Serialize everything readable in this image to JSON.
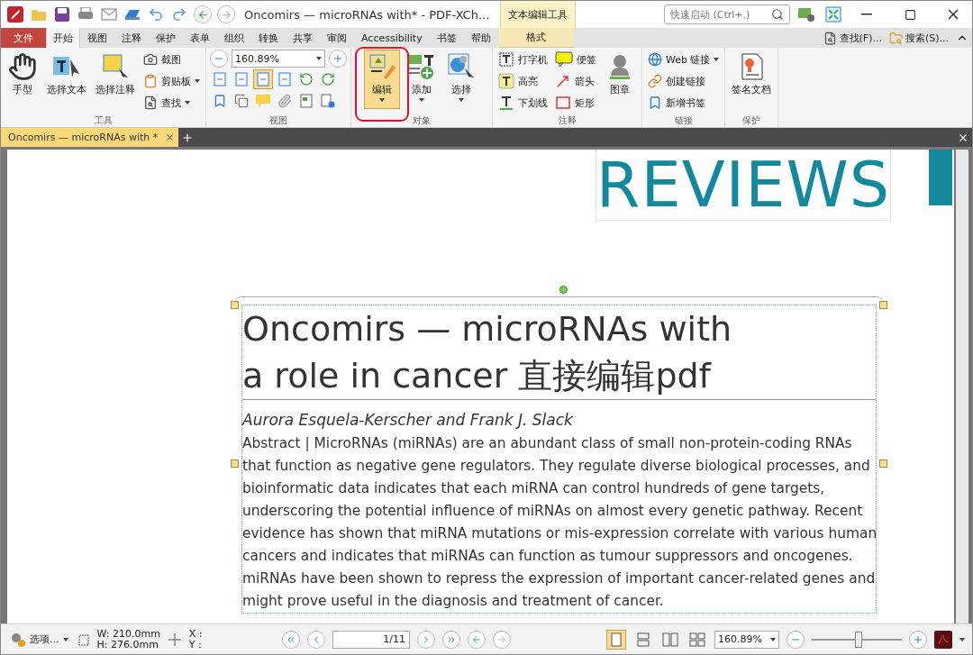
{
  "title_bar": {
    "title": "Oncomirs — microRNAs with* - PDF-XCh...",
    "context_header": "文本编辑工具",
    "quick_launch": {
      "placeholder": "快速启动 (Ctrl+.)"
    }
  },
  "menu_tabs": [
    {
      "label": "文件",
      "kind": "file",
      "selected": false
    },
    {
      "label": "开始",
      "kind": "tab",
      "selected": true
    },
    {
      "label": "视图",
      "kind": "tab",
      "selected": false
    },
    {
      "label": "注释",
      "kind": "tab",
      "selected": false
    },
    {
      "label": "保护",
      "kind": "tab",
      "selected": false
    },
    {
      "label": "表单",
      "kind": "tab",
      "selected": false
    },
    {
      "label": "组织",
      "kind": "tab",
      "selected": false
    },
    {
      "label": "转换",
      "kind": "tab",
      "selected": false
    },
    {
      "label": "共享",
      "kind": "tab",
      "selected": false
    },
    {
      "label": "审阅",
      "kind": "tab",
      "selected": false
    },
    {
      "label": "Accessibility",
      "kind": "tab",
      "selected": false
    },
    {
      "label": "书签",
      "kind": "tab",
      "selected": false
    },
    {
      "label": "帮助",
      "kind": "tab",
      "selected": false
    },
    {
      "label": "格式",
      "kind": "context",
      "selected": false
    }
  ],
  "menu_right": [
    {
      "label": "查找(F)..."
    },
    {
      "label": "搜索(S)..."
    }
  ],
  "ribbon": {
    "tools": {
      "label": "工具",
      "large": [
        {
          "label": "手型"
        },
        {
          "label": "选择文本"
        },
        {
          "label": "选择注释"
        }
      ],
      "small": [
        {
          "label": "截图",
          "dropdown": false
        },
        {
          "label": "剪贴板",
          "dropdown": true
        },
        {
          "label": "查找",
          "dropdown": true
        }
      ]
    },
    "view": {
      "label": "视图",
      "zoom": "160.89%",
      "fit_buttons": [
        {
          "selected": false
        },
        {
          "selected": false
        },
        {
          "selected": true
        },
        {
          "selected": false
        }
      ]
    },
    "objects": {
      "label": "对象",
      "large": [
        {
          "label": "编辑",
          "selected": true,
          "dropdown": true
        },
        {
          "label": "添加",
          "selected": false,
          "dropdown": true
        },
        {
          "label": "选择",
          "selected": false,
          "dropdown": true
        }
      ]
    },
    "comments": {
      "label": "注释",
      "small": [
        {
          "label": "打字机"
        },
        {
          "label": "便签"
        },
        {
          "label": "高亮"
        },
        {
          "label": "箭头"
        },
        {
          "label": "下划线"
        },
        {
          "label": "矩形"
        }
      ],
      "stamp": {
        "label": "图章"
      }
    },
    "links": {
      "label": "链接",
      "small": [
        {
          "label": "Web 链接",
          "dropdown": true
        },
        {
          "label": "创建链接",
          "dropdown": false
        },
        {
          "label": "新增书签",
          "dropdown": false
        }
      ]
    },
    "protect": {
      "label": "保护",
      "large": [
        {
          "label": "签名文档"
        }
      ]
    }
  },
  "doc_tabs": [
    {
      "label": "Oncomirs — microRNAs with *",
      "selected": true
    }
  ],
  "document": {
    "logo": "REVIEWS",
    "title_lines": [
      "Oncomirs — microRNAs with",
      "a role in cancer 直接编辑pdf"
    ],
    "authors": "Aurora Esquela-Kerscher and Frank J. Slack",
    "abstract_lines": [
      "Abstract | MicroRNAs (miRNAs) are an abundant class of small non-protein-coding RNAs",
      "that function as negative gene regulators. They regulate diverse biological processes, and",
      "bioinformatic data indicates that each miRNA can control hundreds of gene targets,",
      "underscoring the potential influence of miRNAs on almost every genetic pathway. Recent",
      "evidence has shown that miRNA mutations or mis-expression correlate with various human",
      "cancers and indicates that miRNAs can function as tumour suppressors and oncogenes.",
      "miRNAs have been shown to repress the expression of important cancer-related genes and",
      "might prove useful in the diagnosis and treatment of cancer."
    ]
  },
  "status_bar": {
    "options": "选项...",
    "width": "W: 210.0mm",
    "height": "H: 276.0mm",
    "x": "X :",
    "y": "Y :",
    "page": "1/11",
    "zoom": "160.89%",
    "zoom_slider": {
      "level": 0.52
    }
  }
}
